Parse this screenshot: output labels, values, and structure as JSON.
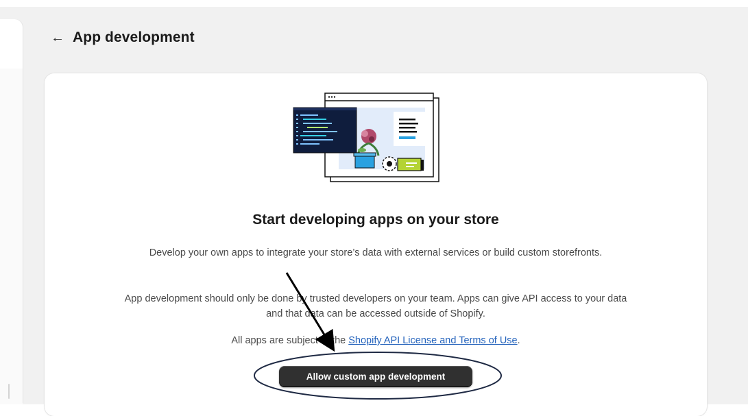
{
  "header": {
    "back_icon": "←",
    "title": "App development"
  },
  "empty_state": {
    "illustration": "app-development-illustration",
    "heading": "Start developing apps on your store",
    "paragraph1": "Develop your own apps to integrate your store’s data with external services or build custom storefronts.",
    "paragraph2": "App development should only be done by trusted developers on your team. Apps can give API access to your data and that data can be accessed outside of Shopify.",
    "paragraph3_prefix": "All apps are subject to the ",
    "license_link": "Shopify API License and Terms of Use",
    "paragraph3_suffix": ".",
    "button_label": "Allow custom app development"
  },
  "icons": {
    "back": "arrow-left-icon",
    "annotation_arrow": "annotation-arrow",
    "annotation_circle": "annotation-ellipse"
  },
  "colors": {
    "background": "#f1f1f1",
    "card": "#ffffff",
    "link": "#2463bc",
    "button": "#303030",
    "annotation": "#1f2a44"
  }
}
